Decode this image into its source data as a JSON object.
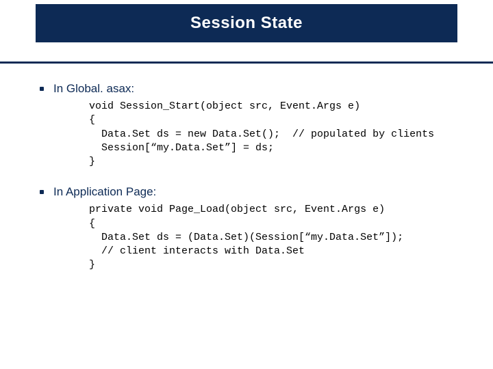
{
  "title": "Session State",
  "bullets": [
    {
      "label": "In Global. asax:",
      "code": "void Session_Start(object src, Event.Args e)\n{\n  Data.Set ds = new Data.Set();  // populated by clients\n  Session[“my.Data.Set”] = ds;\n}"
    },
    {
      "label": "In Application Page:",
      "code": "private void Page_Load(object src, Event.Args e)\n{\n  Data.Set ds = (Data.Set)(Session[“my.Data.Set”]);\n  // client interacts with Data.Set\n}"
    }
  ]
}
